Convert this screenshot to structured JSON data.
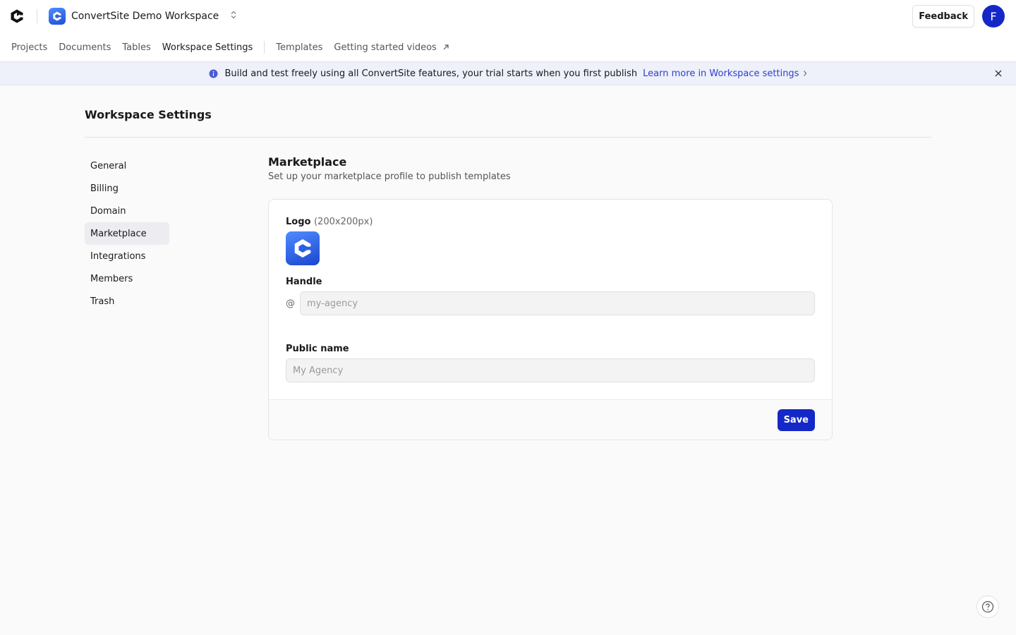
{
  "header": {
    "workspace_name": "ConvertSite Demo Workspace",
    "feedback_label": "Feedback",
    "user_initial": "F"
  },
  "nav": {
    "items": [
      {
        "label": "Projects"
      },
      {
        "label": "Documents"
      },
      {
        "label": "Tables"
      },
      {
        "label": "Workspace Settings",
        "active": true
      },
      {
        "label": "Templates"
      },
      {
        "label": "Getting started videos",
        "external": true
      }
    ]
  },
  "banner": {
    "text": "Build and test freely using all ConvertSite features, your trial starts when you first publish",
    "link": "Learn more in Workspace settings"
  },
  "page": {
    "title": "Workspace Settings"
  },
  "sidebar": {
    "items": [
      {
        "label": "General"
      },
      {
        "label": "Billing"
      },
      {
        "label": "Domain"
      },
      {
        "label": "Marketplace",
        "active": true
      },
      {
        "label": "Integrations"
      },
      {
        "label": "Members"
      },
      {
        "label": "Trash"
      }
    ]
  },
  "marketplace": {
    "title": "Marketplace",
    "subtitle": "Set up your marketplace profile to publish templates",
    "logo_label": "Logo",
    "logo_hint": "(200x200px)",
    "handle_label": "Handle",
    "handle_prefix": "@",
    "handle_placeholder": "my-agency",
    "handle_value": "",
    "public_name_label": "Public name",
    "public_name_placeholder": "My Agency",
    "public_name_value": "",
    "save_label": "Save"
  },
  "colors": {
    "accent": "#1428c8",
    "link": "#2f3fce",
    "banner_bg": "#eef0fa",
    "brand_gradient_start": "#4f8cff",
    "brand_gradient_end": "#1b45cf"
  },
  "icons": {
    "app_logo": "convertsite-logo-icon",
    "workspace": "convertsite-cube-icon",
    "switcher": "chevron-up-down-icon",
    "external": "arrow-up-right-icon",
    "info": "info-circle-icon",
    "banner_chevron": "chevron-right-icon",
    "close": "close-icon",
    "help": "help-circle-icon"
  }
}
